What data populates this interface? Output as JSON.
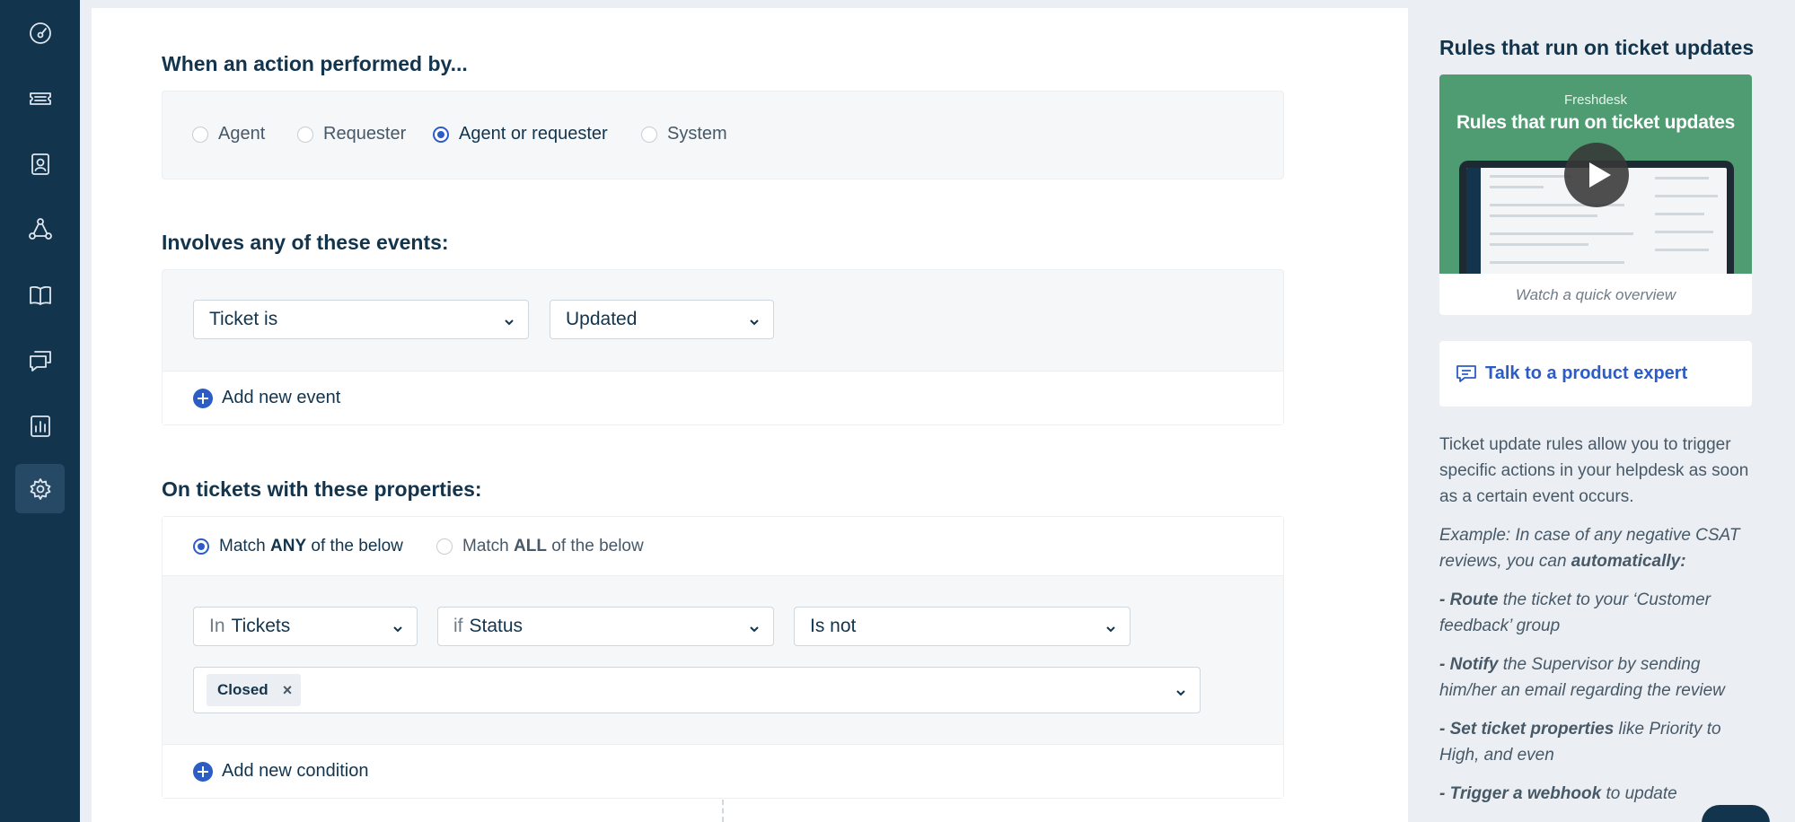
{
  "sidebar": {
    "items": [
      {
        "icon": "dashboard-icon",
        "active": false
      },
      {
        "icon": "ticket-icon",
        "active": false
      },
      {
        "icon": "contacts-icon",
        "active": false
      },
      {
        "icon": "groups-icon",
        "active": false
      },
      {
        "icon": "knowledge-base-icon",
        "active": false
      },
      {
        "icon": "discussions-icon",
        "active": false
      },
      {
        "icon": "reports-icon",
        "active": false
      },
      {
        "icon": "admin-gear-icon",
        "active": true
      }
    ]
  },
  "performed_by": {
    "heading": "When an action performed by...",
    "options": [
      "Agent",
      "Requester",
      "Agent or requester",
      "System"
    ],
    "selected": "Agent or requester"
  },
  "events": {
    "heading": "Involves any of these events:",
    "field_select": "Ticket is",
    "value_select": "Updated",
    "add_label": "Add new event"
  },
  "properties": {
    "heading": "On tickets with these properties:",
    "match_any": {
      "pre": "Match ",
      "strong": "ANY",
      "post": " of the below"
    },
    "match_all": {
      "pre": "Match ",
      "strong": "ALL",
      "post": " of the below"
    },
    "selected": "any",
    "condition": {
      "in_prefix": "In",
      "in_value": "Tickets",
      "if_prefix": "if",
      "if_value": "Status",
      "operator": "Is not",
      "chip_value": "Closed",
      "chip_remove": "×"
    },
    "add_label": "Add new condition"
  },
  "right_panel": {
    "title": "Rules that run on ticket updates",
    "video": {
      "brand": "Freshdesk",
      "title": "Rules that run on ticket updates",
      "caption": "Watch a quick overview"
    },
    "expert_label": "Talk to a product expert",
    "desc_intro": "Ticket update rules allow you to trigger specific actions in your helpdesk as soon as a certain event occurs.",
    "example_pre": "Example: In case of any negative CSAT reviews, you can ",
    "example_strong": "automatically:",
    "bullets": [
      {
        "strong": "- Route",
        "text": " the ticket to your ‘Customer feedback’ group"
      },
      {
        "strong": "- Notify",
        "text": " the Supervisor by sending him/her an email regarding the review"
      },
      {
        "strong": "- Set ticket properties",
        "text": " like Priority to High, and even"
      },
      {
        "strong": "- Trigger a webhook",
        "text": " to update"
      }
    ]
  },
  "colors": {
    "sidebar": "#12344d",
    "accent": "#2c5cc5",
    "panel_bg": "#f5f7f9",
    "video_bg": "#4f9b72"
  }
}
